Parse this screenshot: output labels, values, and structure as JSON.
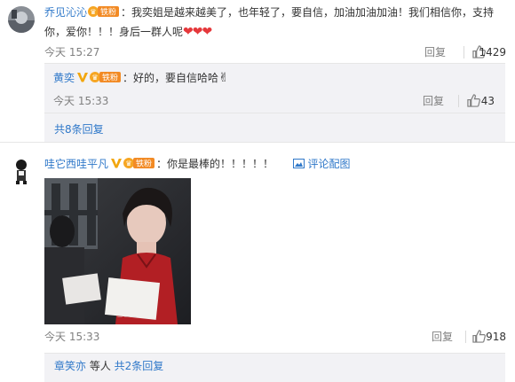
{
  "comments": [
    {
      "username": "乔见沁沁",
      "fan_badge": "铁粉",
      "text_line1": "：我奕姐是越来越美了，也年轻了，要自信，加油加油加油！我们相信你，支持",
      "text_line2": "你，爱你！！！身后一群人呢",
      "time": "今天 15:27",
      "reply_label": "回复",
      "like_count": "1429",
      "replies": [
        {
          "username": "黄奕",
          "fan_badge": "铁粉",
          "text": "：好的，要自信哈哈",
          "time": "今天 15:33",
          "reply_label": "回复",
          "like_count": "43"
        }
      ],
      "more_replies": "共8条回复"
    },
    {
      "username": "哇它西哇平凡",
      "fan_badge": "铁粉",
      "text": "：你是最棒的！！！！！",
      "pic_link": "评论配图",
      "time": "今天 15:33",
      "reply_label": "回复",
      "like_count": "918",
      "reply_summary": {
        "username": "章笑亦",
        "text": " 等人 ",
        "count_link": "共2条回复"
      }
    }
  ],
  "colors": {
    "link_blue": "#2f78c9",
    "username_orange": "#eb7350",
    "reply_bg": "#f2f2f5",
    "heart_red": "#e5383b"
  }
}
